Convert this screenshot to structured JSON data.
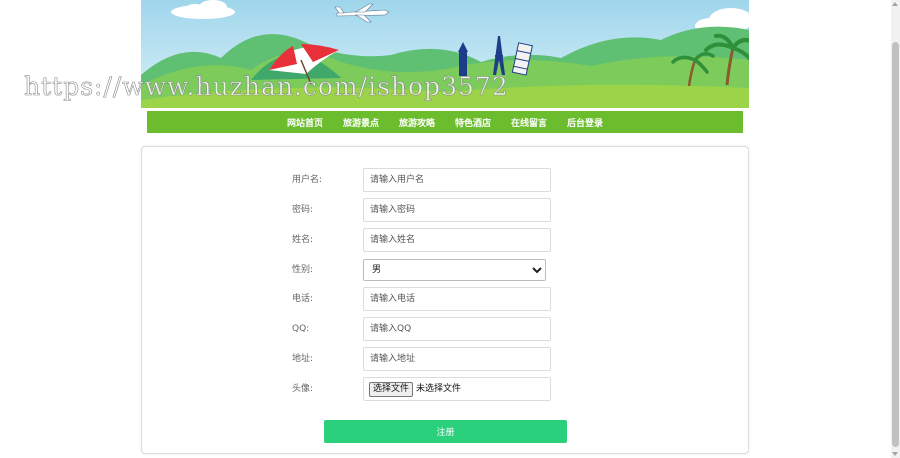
{
  "banner": {
    "watermark": "https://www.huzhan.com/ishop3572"
  },
  "nav": {
    "items": [
      {
        "label": "网站首页"
      },
      {
        "label": "旅游景点"
      },
      {
        "label": "旅游攻略"
      },
      {
        "label": "特色酒店"
      },
      {
        "label": "在线留言"
      },
      {
        "label": "后台登录"
      }
    ]
  },
  "form": {
    "username": {
      "label": "用户名:",
      "placeholder": "请输入用户名",
      "value": ""
    },
    "password": {
      "label": "密码:",
      "placeholder": "请输入密码",
      "value": ""
    },
    "name": {
      "label": "姓名:",
      "placeholder": "请输入姓名",
      "value": ""
    },
    "gender": {
      "label": "性别:",
      "selected": "男"
    },
    "phone": {
      "label": "电话:",
      "placeholder": "请输入电话",
      "value": ""
    },
    "qq": {
      "label": "QQ:",
      "placeholder": "请输入QQ",
      "value": ""
    },
    "address": {
      "label": "地址:",
      "placeholder": "请输入地址",
      "value": ""
    },
    "avatar": {
      "label": "头像:",
      "button_label": "选择文件",
      "status": "未选择文件"
    },
    "submit_label": "注册"
  },
  "colors": {
    "nav_bg": "#6cbd2e",
    "submit_bg": "#2bd07c",
    "sky": "#aedcee",
    "grass": "#8ccf3c"
  },
  "icons": {
    "banner_plane": "airplane-icon",
    "banner_umbrella": "umbrella-icon",
    "banner_eiffel": "eiffel-tower-icon",
    "banner_tower": "leaning-tower-icon",
    "banner_palm": "palm-tree-icon",
    "select_arrow": "chevron-down-icon"
  }
}
